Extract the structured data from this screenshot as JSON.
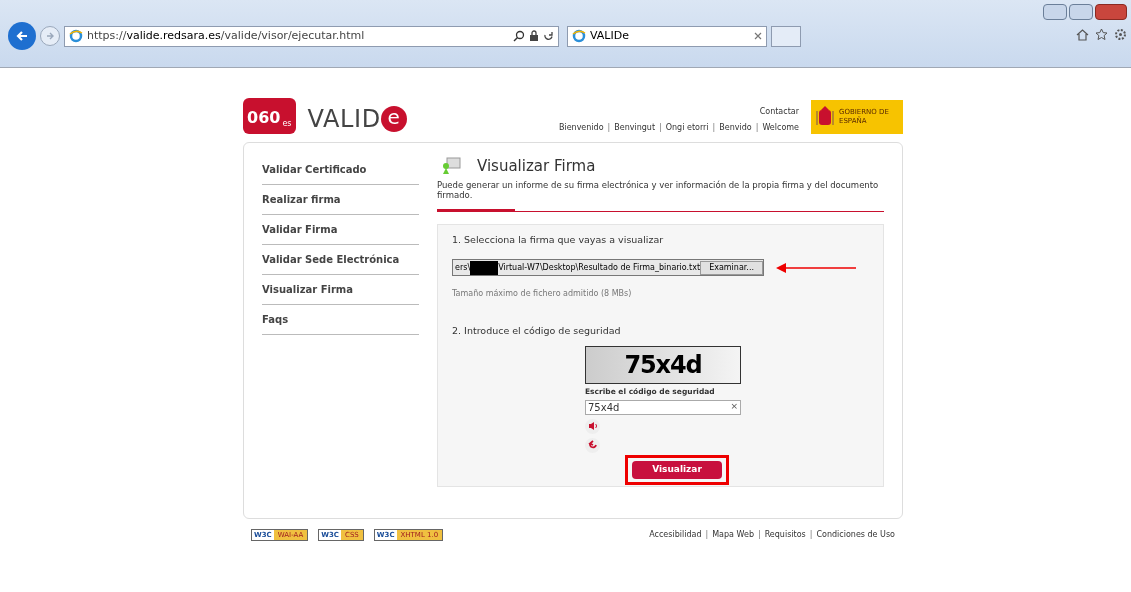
{
  "browser": {
    "address_scheme": "https://",
    "address_host": "valide.redsara.es",
    "address_path": "/valide/visor/ejecutar.html",
    "tab_title": "VALIDe"
  },
  "header": {
    "logo_badge": "060",
    "logo_badge_suffix": "es",
    "logo_text": "VALID",
    "logo_letter": "e",
    "contact": "Contactar",
    "languages": [
      "Bienvenido",
      "Benvingut",
      "Ongi etorri",
      "Benvido",
      "Welcome"
    ],
    "separator": "|",
    "gov_label": "GOBIERNO DE ESPAÑA"
  },
  "sidebar": {
    "items": [
      {
        "label": "Validar Certificado",
        "selected": false
      },
      {
        "label": "Realizar firma",
        "selected": false
      },
      {
        "label": "Validar Firma",
        "selected": false
      },
      {
        "label": "Validar Sede Electrónica",
        "selected": false
      },
      {
        "label": "Visualizar Firma",
        "selected": false
      },
      {
        "label": "Faqs",
        "selected": false
      }
    ]
  },
  "main": {
    "title": "Visualizar Firma",
    "description": "Puede generar un informe de su firma electrónica y ver información de la propia firma y del documento firmado.",
    "step1": "1. Selecciona la firma que vayas a visualizar",
    "file_path_start": "ers\\",
    "file_path_end": "Virtual-W7\\Desktop\\Resultado de Firma_binario.txt",
    "browse_button": "Examinar...",
    "max_size": "Tamaño máximo de fichero admitido (8 MBs)",
    "step2": "2. Introduce el código de seguridad",
    "captcha_text": "75x4d",
    "captcha_label": "Escribe el código de seguridad",
    "captcha_value": "75x4d",
    "clear": "×",
    "submit": "Visualizar"
  },
  "footer": {
    "badges": [
      {
        "w3c": "W3C",
        "label": "WAI-AA"
      },
      {
        "w3c": "W3C",
        "label": "CSS"
      },
      {
        "w3c": "W3C",
        "label": "XHTML 1.0"
      }
    ],
    "links": [
      "Accesibilidad",
      "Mapa Web",
      "Requisitos",
      "Condiciones de Uso"
    ],
    "separator": "|"
  }
}
